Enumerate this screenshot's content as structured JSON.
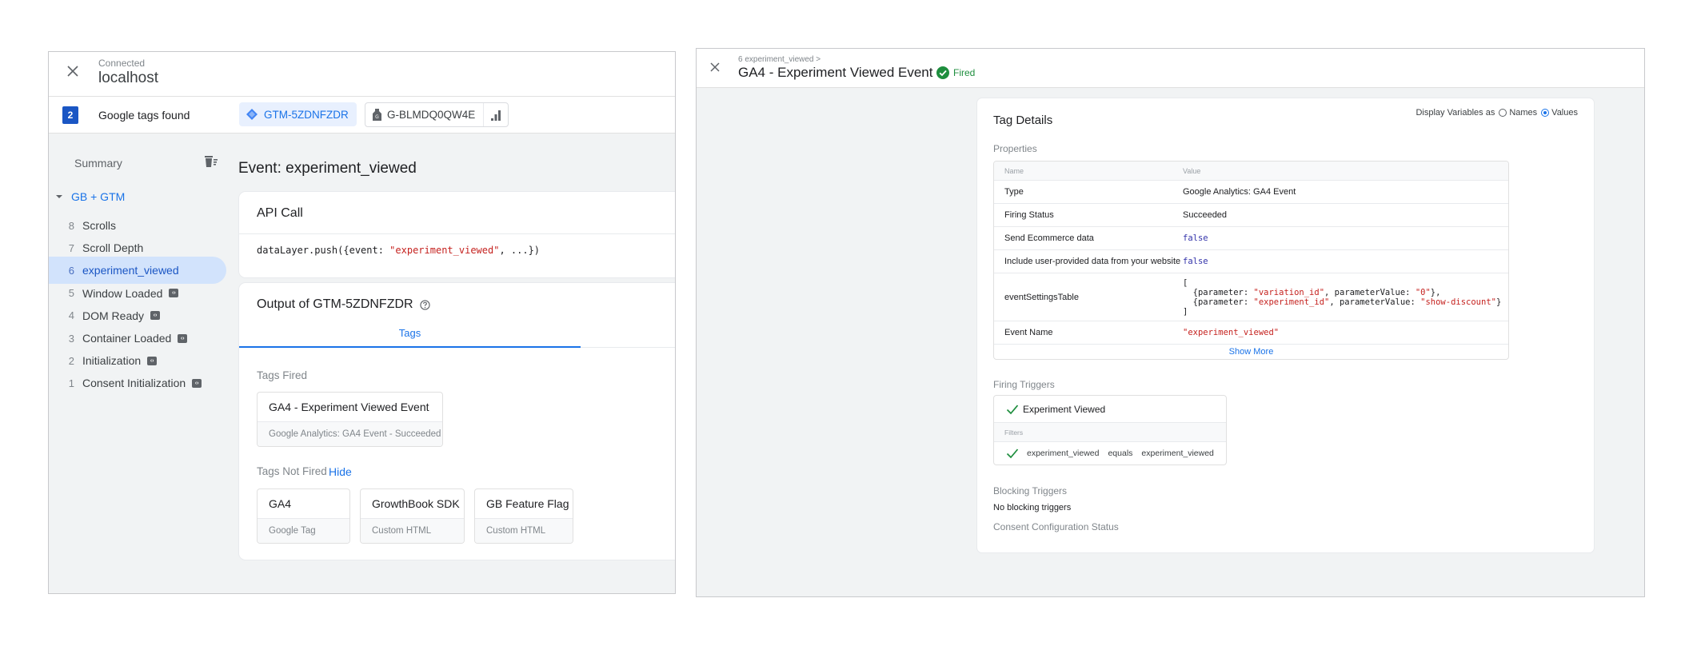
{
  "left_panel": {
    "header": {
      "status": "Connected",
      "host": "localhost"
    },
    "tags_bar": {
      "count": "2",
      "label": "Google tags found",
      "gtm_container": "GTM-5ZDNFZDR",
      "ga_tag": "G-BLMDQ0QW4E"
    },
    "sidebar": {
      "summary_label": "Summary",
      "group_label": "GB + GTM",
      "events": [
        {
          "num": "8",
          "label": "Scrolls",
          "code_icon": false,
          "selected": false
        },
        {
          "num": "7",
          "label": "Scroll Depth",
          "code_icon": false,
          "selected": false
        },
        {
          "num": "6",
          "label": "experiment_viewed",
          "code_icon": false,
          "selected": true
        },
        {
          "num": "5",
          "label": "Window Loaded",
          "code_icon": true,
          "selected": false
        },
        {
          "num": "4",
          "label": "DOM Ready",
          "code_icon": true,
          "selected": false
        },
        {
          "num": "3",
          "label": "Container Loaded",
          "code_icon": true,
          "selected": false
        },
        {
          "num": "2",
          "label": "Initialization",
          "code_icon": true,
          "selected": false
        },
        {
          "num": "1",
          "label": "Consent Initialization",
          "code_icon": true,
          "selected": false
        }
      ]
    },
    "main": {
      "event_title": "Event: experiment_viewed",
      "api_call": {
        "title": "API Call",
        "code_prefix": "dataLayer.push({event: ",
        "code_string": "\"experiment_viewed\"",
        "code_suffix": ", ...})"
      },
      "output": {
        "title": "Output of GTM-5ZDNFZDR",
        "tab_label": "Tags",
        "fired_label": "Tags Fired",
        "fired_tags": [
          {
            "name": "GA4 - Experiment Viewed Event",
            "sub": "Google Analytics: GA4 Event - Succeeded"
          }
        ],
        "not_fired_label": "Tags Not Fired",
        "hide_link": "Hide",
        "not_fired_tags": [
          {
            "name": "GA4",
            "sub": "Google Tag"
          },
          {
            "name": "GrowthBook SDK",
            "sub": "Custom HTML"
          },
          {
            "name": "GB Feature Flag",
            "sub": "Custom HTML"
          }
        ]
      }
    }
  },
  "right_panel": {
    "header": {
      "breadcrumb": "6 experiment_viewed >",
      "title": "GA4 - Experiment Viewed Event",
      "status": "Fired",
      "status_color": "#1e8e3e"
    },
    "details": {
      "title": "Tag Details",
      "display_vars_label": "Display Variables as",
      "display_options": [
        "Names",
        "Values"
      ],
      "display_selected": "Values",
      "properties_label": "Properties",
      "table_headers": {
        "name": "Name",
        "value": "Value"
      },
      "properties": [
        {
          "name": "Type",
          "value": "Google Analytics: GA4 Event"
        },
        {
          "name": "Firing Status",
          "value": "Succeeded"
        },
        {
          "name": "Send Ecommerce data",
          "value": "false"
        },
        {
          "name": "Include user-provided data from your website",
          "value": "false"
        },
        {
          "name": "eventSettingsTable",
          "value_lines": [
            "[",
            "  {parameter: \"variation_id\", parameterValue: \"0\"},",
            "  {parameter: \"experiment_id\", parameterValue: \"show-discount\"}",
            "]"
          ]
        },
        {
          "name": "Event Name",
          "value": "\"experiment_viewed\""
        }
      ],
      "show_more": "Show More",
      "firing_triggers_label": "Firing Triggers",
      "trigger": {
        "name": "Experiment Viewed",
        "filters_label": "Filters",
        "filter": {
          "variable": "experiment_viewed",
          "operator": "equals",
          "value": "experiment_viewed"
        }
      },
      "blocking_triggers_label": "Blocking Triggers",
      "blocking_triggers_text": "No blocking triggers",
      "consent_label": "Consent Configuration Status"
    }
  },
  "colors": {
    "accent": "#1a73e8",
    "selected_bg": "#d2e3fc",
    "string": "#c5221f",
    "boolean": "#3333aa",
    "success": "#1e8e3e"
  }
}
